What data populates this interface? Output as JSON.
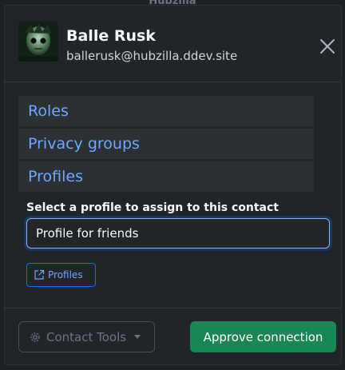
{
  "backdrop": {
    "title": "Hubzilla"
  },
  "header": {
    "name": "Balle Rusk",
    "address": "ballerusk@hubzilla.ddev.site",
    "avatar_icon": "contact-avatar",
    "close_icon": "close-icon"
  },
  "sections": [
    {
      "label": "Roles"
    },
    {
      "label": "Privacy groups"
    },
    {
      "label": "Profiles"
    }
  ],
  "profile_assign": {
    "label": "Select a profile to assign to this contact",
    "selected": "Profile for friends"
  },
  "profiles_button": {
    "label": "Profiles",
    "icon": "external-link-icon"
  },
  "footer": {
    "tools_label": "Contact Tools",
    "tools_icon": "gear-icon",
    "approve_label": "Approve connection"
  },
  "colors": {
    "background": "#212529",
    "link": "#6ea8fe",
    "primary": "#0d6efd",
    "success": "#198754"
  }
}
